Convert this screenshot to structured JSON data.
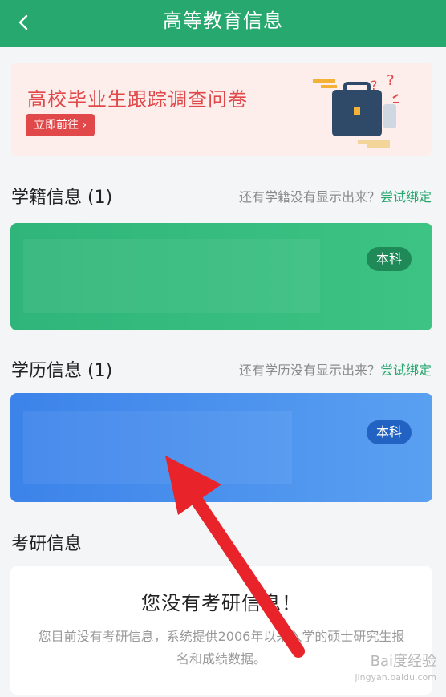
{
  "header": {
    "title": "高等教育信息",
    "back_icon": "chevron-left-icon"
  },
  "banner": {
    "title": "高校毕业生跟踪调查问卷",
    "button_label": "立即前往",
    "illustration_icon": "briefcase-icon"
  },
  "enrollment": {
    "title": "学籍信息 (1)",
    "hint_prefix": "还有学籍没有显示出来？",
    "hint_link": "尝试绑定",
    "card": {
      "badge": "本科",
      "color": "#2fb579"
    }
  },
  "degree": {
    "title": "学历信息 (1)",
    "hint_prefix": "还有学历没有显示出来？",
    "hint_link": "尝试绑定",
    "card": {
      "badge": "本科",
      "color": "#3c83ea"
    }
  },
  "postgrad": {
    "title": "考研信息",
    "empty_title": "您没有考研信息！",
    "empty_desc": "您目前没有考研信息，系统提供2006年以来入学的硕士研究生报名和成绩数据。"
  },
  "watermark": {
    "text": "Bai度经验",
    "sub": "jingyan.baidu.com"
  },
  "colors": {
    "accent": "#26a86e",
    "banner_text": "#e0484a",
    "annotation_arrow": "#e8232a"
  }
}
